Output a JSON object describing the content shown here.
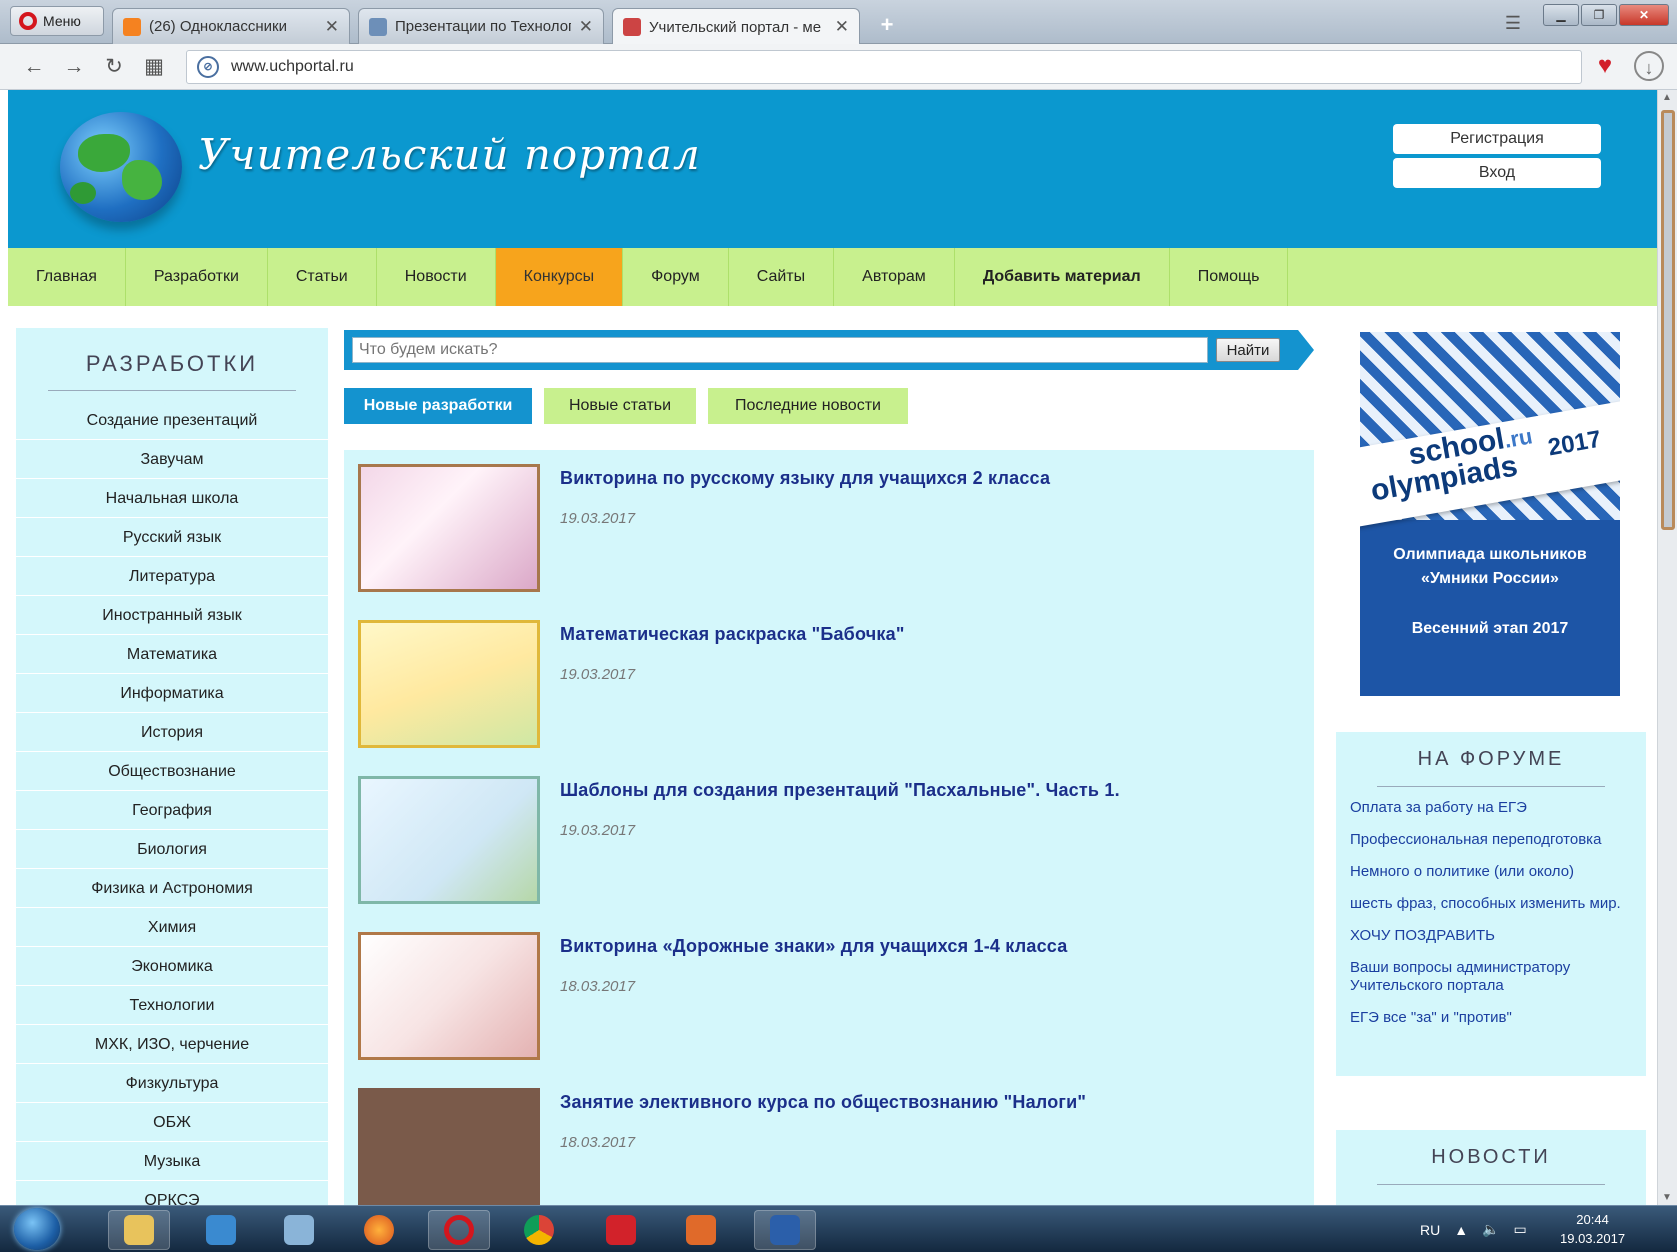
{
  "browser": {
    "menu_label": "Меню",
    "tabs": [
      {
        "title": "(26) Одноклассники"
      },
      {
        "title": "Презентации по Технологии"
      },
      {
        "title": "Учительский портал - ме"
      }
    ],
    "new_tab": "+",
    "url": "www.uchportal.ru"
  },
  "site": {
    "logo_text": "Учительский портал",
    "register_label": "Регистрация",
    "login_label": "Вход",
    "nav": [
      {
        "label": "Главная"
      },
      {
        "label": "Разработки"
      },
      {
        "label": "Статьи"
      },
      {
        "label": "Новости"
      },
      {
        "label": "Конкурсы"
      },
      {
        "label": "Форум"
      },
      {
        "label": "Сайты"
      },
      {
        "label": "Авторам"
      },
      {
        "label": "Добавить материал"
      },
      {
        "label": "Помощь"
      }
    ],
    "nav_active": "Конкурсы"
  },
  "sidebar": {
    "title": "РАЗРАБОТКИ",
    "items": [
      "Создание презентаций",
      "Завучам",
      "Начальная школа",
      "Русский язык",
      "Литература",
      "Иностранный язык",
      "Математика",
      "Информатика",
      "История",
      "Обществознание",
      "География",
      "Биология",
      "Физика и Астрономия",
      "Химия",
      "Экономика",
      "Технологии",
      "МХК, ИЗО, черчение",
      "Физкультура",
      "ОБЖ",
      "Музыка",
      "ОРКСЭ"
    ]
  },
  "search": {
    "placeholder": "Что будем искать?",
    "button": "Найти"
  },
  "content_tabs": [
    "Новые разработки",
    "Новые статьи",
    "Последние новости"
  ],
  "entries": [
    {
      "title": "Викторина по русскому языку для учащихся 2 класса",
      "date": "19.03.2017"
    },
    {
      "title": "Математическая раскраска \"Бабочка\"",
      "date": "19.03.2017"
    },
    {
      "title": "Шаблоны для создания презентаций \"Пасхальные\". Часть 1.",
      "date": "19.03.2017"
    },
    {
      "title": "Викторина «Дорожные знаки» для учащихся 1-4 класса",
      "date": "18.03.2017"
    },
    {
      "title": "Занятие элективного курса по обществознанию \"Налоги\"",
      "date": "18.03.2017"
    }
  ],
  "ad": {
    "brand": "school",
    "brand_suffix": ".ru",
    "brand2": "olympiads",
    "year": "2017",
    "line1": "Олимпиада школьников",
    "line2": "«Умники России»",
    "line3": "Весенний этап 2017"
  },
  "forum": {
    "title": "НА ФОРУМЕ",
    "links": [
      "Оплата за работу на ЕГЭ",
      "Профессиональная переподготовка",
      "Немного о политике (или около)",
      "шесть фраз, способных изменить мир.",
      "ХОЧУ ПОЗДРАВИТЬ",
      "Ваши вопросы администратору Учительского портала",
      "ЕГЭ все \"за\" и \"против\""
    ]
  },
  "news": {
    "title": "НОВОСТИ"
  },
  "taskbar": {
    "lang": "RU",
    "time": "20:44",
    "date": "19.03.2017"
  },
  "colors": {
    "header_blue": "#0b98cf",
    "nav_green": "#c8f08e",
    "nav_active_orange": "#f7a41c",
    "panel_cyan": "#d4f7fb",
    "link_navy": "#1b2f8a"
  }
}
